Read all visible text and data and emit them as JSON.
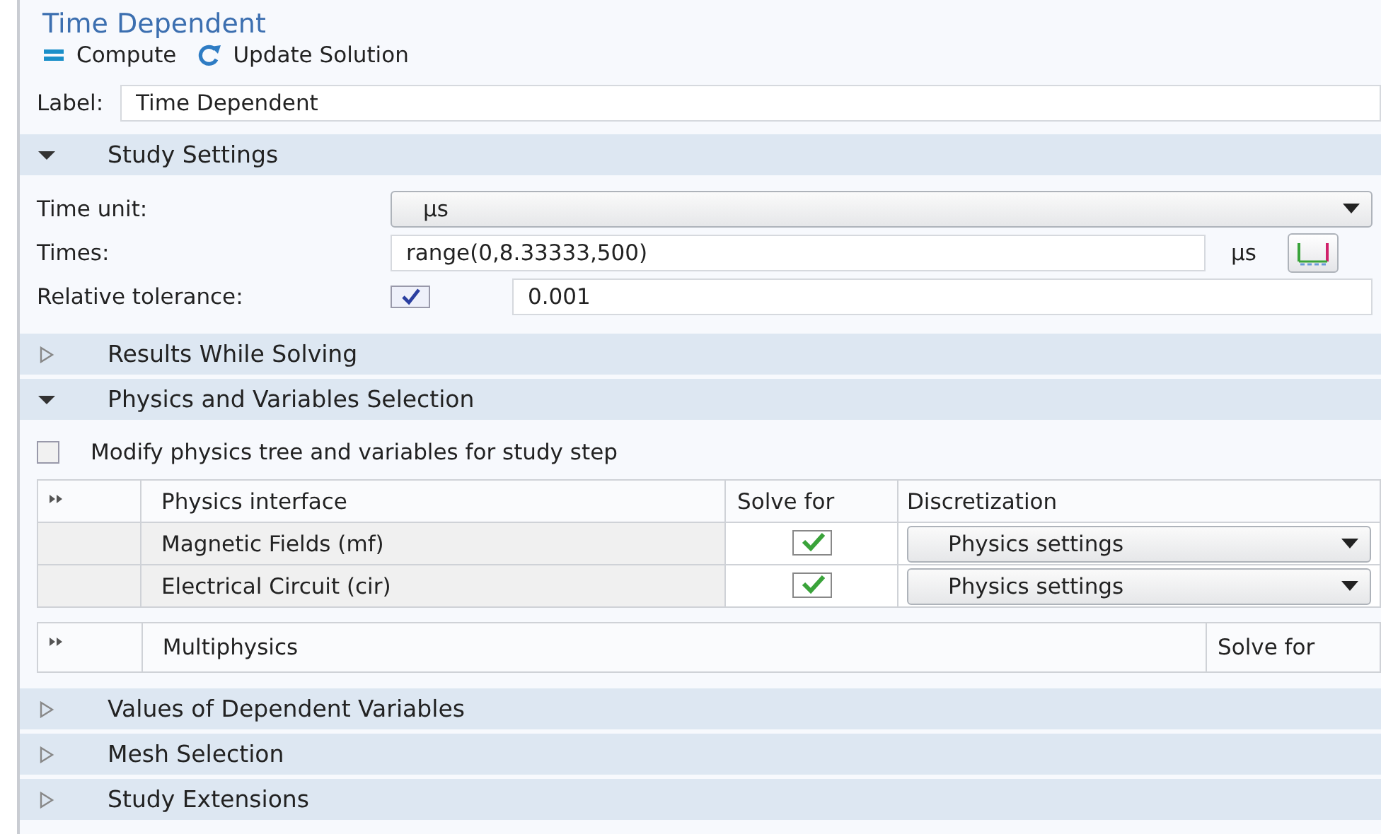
{
  "title": "Time Dependent",
  "toolbar": [
    {
      "label": "Compute",
      "kind": "compute"
    },
    {
      "label": "Update Solution",
      "kind": "update"
    }
  ],
  "label_field": {
    "label": "Label:",
    "value": "Time Dependent"
  },
  "sections": [
    {
      "title": "Study Settings",
      "expanded": true,
      "kind": "study",
      "time_unit": {
        "label": "Time unit:",
        "value": "µs"
      },
      "times": {
        "label": "Times:",
        "value": "range(0,8.33333,500)",
        "unit": "µs"
      },
      "tolerance": {
        "label": "Relative tolerance:",
        "checked": true,
        "value": "0.001"
      }
    },
    {
      "title": "Results While Solving",
      "expanded": false
    },
    {
      "title": "Physics and Variables Selection",
      "expanded": true,
      "kind": "physics",
      "modify": {
        "label": "Modify physics tree and variables for study step",
        "checked": false
      },
      "columns": [
        "Physics interface",
        "Solve for",
        "Discretization"
      ],
      "rows": [
        {
          "name": "Magnetic Fields (mf)",
          "solve_for": true,
          "discretization": "Physics settings"
        },
        {
          "name": "Electrical Circuit (cir)",
          "solve_for": true,
          "discretization": "Physics settings"
        }
      ],
      "multiphysics_columns": [
        "Multiphysics",
        "Solve for"
      ]
    },
    {
      "title": "Values of Dependent Variables",
      "expanded": false
    },
    {
      "title": "Mesh Selection",
      "expanded": false
    },
    {
      "title": "Study Extensions",
      "expanded": false
    }
  ]
}
